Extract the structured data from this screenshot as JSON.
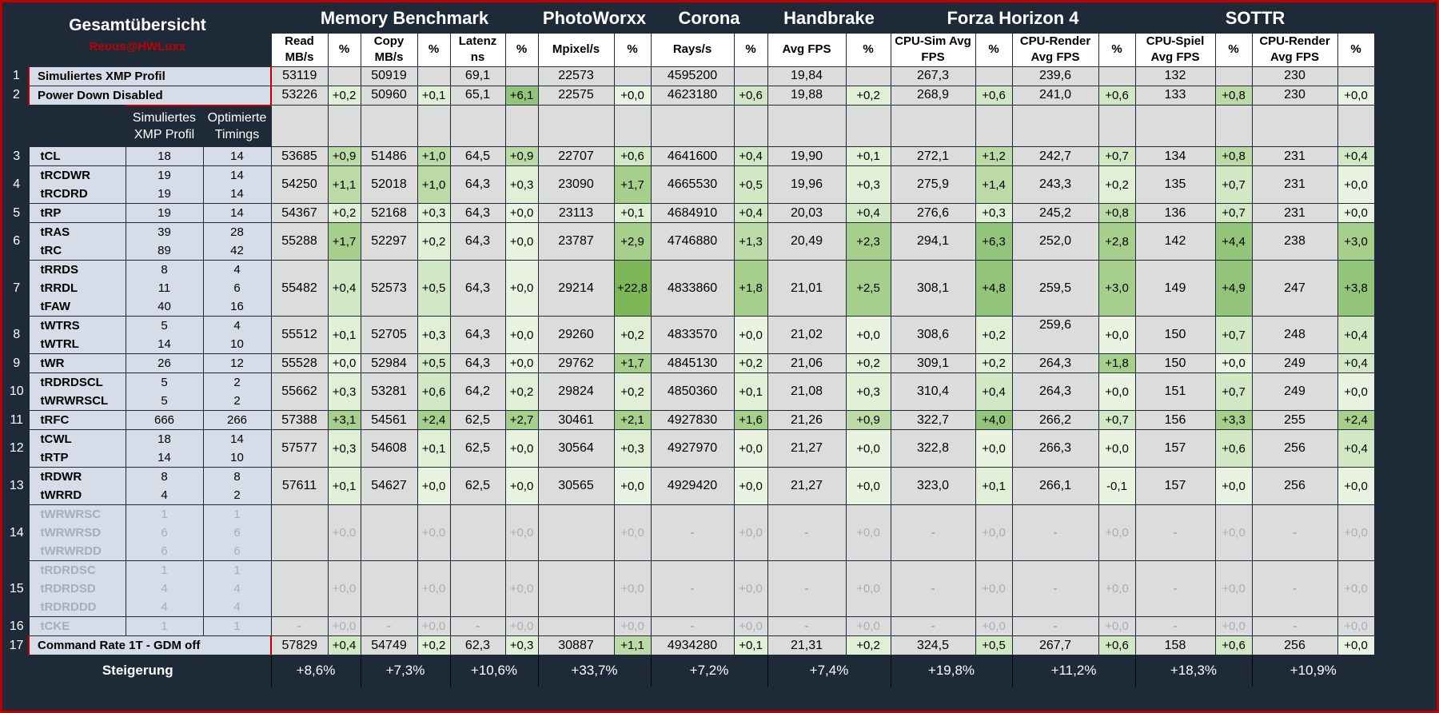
{
  "title": "Gesamtübersicht",
  "author": "Reous@HWLuxx",
  "groups": [
    "Memory Benchmark",
    "PhotoWorxx",
    "Corona",
    "Handbrake",
    "Forza Horizon 4",
    "SOTTR"
  ],
  "col_headers": [
    "Read MB/s",
    "%",
    "Copy MB/s",
    "%",
    "Latenz ns",
    "%",
    "Mpixel/s",
    "%",
    "Rays/s",
    "%",
    "Avg FPS",
    "%",
    "CPU-Sim Avg FPS",
    "%",
    "CPU-Render Avg FPS",
    "%",
    "CPU-Spiel Avg FPS",
    "%",
    "CPU-Render Avg FPS",
    "%"
  ],
  "timing_headers": [
    "Simuliertes XMP Profil",
    "Optimierte Timings"
  ],
  "footer_label": "Steigerung",
  "footer": [
    "+8,6%",
    "+7,3%",
    "+10,6%",
    "+33,7%",
    "+7,2%",
    "+7,4%",
    "+19,8%",
    "+11,2%",
    "+18,3%",
    "+10,9%"
  ],
  "colors": {
    "background": "#1f2a38",
    "accent": "#c00000",
    "label_bg": "#d6dde8",
    "data_bg": "#dcdcdc",
    "header_bg": "#ffffff"
  },
  "rows": [
    {
      "n": "1",
      "labels": [
        "Simuliertes XMP Profil"
      ],
      "values": [
        "53119",
        "",
        "50919",
        "",
        "69,1",
        "",
        "22573",
        "",
        "4595200",
        "",
        "19,84",
        "",
        "267,3",
        "",
        "239,6",
        "",
        "132",
        "",
        "230",
        ""
      ]
    },
    {
      "n": "2",
      "labels": [
        "Power Down Disabled"
      ],
      "values": [
        "53226",
        "+0,2",
        "50960",
        "+0,1",
        "65,1",
        "+6,1",
        "22575",
        "+0,0",
        "4623180",
        "+0,6",
        "19,88",
        "+0,2",
        "268,9",
        "+0,6",
        "241,0",
        "+0,6",
        "133",
        "+0,8",
        "230",
        "+0,0"
      ]
    },
    {
      "n": "3",
      "labels": [
        "tCL"
      ],
      "xmp": [
        "18"
      ],
      "opt": [
        "14"
      ],
      "values": [
        "53685",
        "+0,9",
        "51486",
        "+1,0",
        "64,5",
        "+0,9",
        "22707",
        "+0,6",
        "4641600",
        "+0,4",
        "19,90",
        "+0,1",
        "272,1",
        "+1,2",
        "242,7",
        "+0,7",
        "134",
        "+0,8",
        "231",
        "+0,4"
      ]
    },
    {
      "n": "4",
      "labels": [
        "tRCDWR",
        "tRCDRD"
      ],
      "xmp": [
        "19",
        "19"
      ],
      "opt": [
        "14",
        "14"
      ],
      "values": [
        "54250",
        "+1,1",
        "52018",
        "+1,0",
        "64,3",
        "+0,3",
        "23090",
        "+1,7",
        "4665530",
        "+0,5",
        "19,96",
        "+0,3",
        "275,9",
        "+1,4",
        "243,3",
        "+0,2",
        "135",
        "+0,7",
        "231",
        "+0,0"
      ]
    },
    {
      "n": "5",
      "labels": [
        "tRP"
      ],
      "xmp": [
        "19"
      ],
      "opt": [
        "14"
      ],
      "values": [
        "54367",
        "+0,2",
        "52168",
        "+0,3",
        "64,3",
        "+0,0",
        "23113",
        "+0,1",
        "4684910",
        "+0,4",
        "20,03",
        "+0,4",
        "276,6",
        "+0,3",
        "245,2",
        "+0,8",
        "136",
        "+0,7",
        "231",
        "+0,0"
      ]
    },
    {
      "n": "6",
      "labels": [
        "tRAS",
        "tRC"
      ],
      "xmp": [
        "39",
        "89"
      ],
      "opt": [
        "28",
        "42"
      ],
      "values": [
        "55288",
        "+1,7",
        "52297",
        "+0,2",
        "64,3",
        "+0,0",
        "23787",
        "+2,9",
        "4746880",
        "+1,3",
        "20,49",
        "+2,3",
        "294,1",
        "+6,3",
        "252,0",
        "+2,8",
        "142",
        "+4,4",
        "238",
        "+3,0"
      ]
    },
    {
      "n": "7",
      "labels": [
        "tRRDS",
        "tRRDL",
        "tFAW"
      ],
      "xmp": [
        "8",
        "11",
        "40"
      ],
      "opt": [
        "4",
        "6",
        "16"
      ],
      "values": [
        "55482",
        "+0,4",
        "52573",
        "+0,5",
        "64,3",
        "+0,0",
        "29214",
        "+22,8",
        "4833860",
        "+1,8",
        "21,01",
        "+2,5",
        "308,1",
        "+4,8",
        "259,5",
        "+3,0",
        "149",
        "+4,9",
        "247",
        "+3,8"
      ]
    },
    {
      "n": "8",
      "labels": [
        "tWTRS",
        "tWTRL"
      ],
      "xmp": [
        "5",
        "14"
      ],
      "opt": [
        "4",
        "10"
      ],
      "values": [
        "55512",
        "+0,1",
        "52705",
        "+0,3",
        "64,3",
        "+0,0",
        "29260",
        "+0,2",
        "4833570",
        "+0,0",
        "21,02",
        "+0,0",
        "308,6",
        "+0,2",
        "259,6",
        "+0,0",
        "150",
        "+0,7",
        "248",
        "+0,4"
      ]
    },
    {
      "n": "9",
      "labels": [
        "tWR"
      ],
      "xmp": [
        "26"
      ],
      "opt": [
        "12"
      ],
      "values": [
        "55528",
        "+0,0",
        "52984",
        "+0,5",
        "64,3",
        "+0,0",
        "29762",
        "+1,7",
        "4845130",
        "+0,2",
        "21,06",
        "+0,2",
        "309,1",
        "+0,2",
        "264,3",
        "+1,8",
        "150",
        "+0,0",
        "249",
        "+0,4"
      ]
    },
    {
      "n": "10",
      "labels": [
        "tRDRDSCL",
        "tWRWRSCL"
      ],
      "xmp": [
        "5",
        "5"
      ],
      "opt": [
        "2",
        "2"
      ],
      "values": [
        "55662",
        "+0,3",
        "53281",
        "+0,6",
        "64,2",
        "+0,2",
        "29824",
        "+0,2",
        "4850360",
        "+0,1",
        "21,08",
        "+0,3",
        "310,4",
        "+0,4",
        "264,3",
        "+0,0",
        "151",
        "+0,7",
        "249",
        "+0,0"
      ]
    },
    {
      "n": "11",
      "labels": [
        "tRFC"
      ],
      "xmp": [
        "666"
      ],
      "opt": [
        "266"
      ],
      "values": [
        "57388",
        "+3,1",
        "54561",
        "+2,4",
        "62,5",
        "+2,7",
        "30461",
        "+2,1",
        "4927830",
        "+1,6",
        "21,26",
        "+0,9",
        "322,7",
        "+4,0",
        "266,2",
        "+0,7",
        "156",
        "+3,3",
        "255",
        "+2,4"
      ]
    },
    {
      "n": "12",
      "labels": [
        "tCWL",
        "tRTP"
      ],
      "xmp": [
        "18",
        "14"
      ],
      "opt": [
        "14",
        "10"
      ],
      "values": [
        "57577",
        "+0,3",
        "54608",
        "+0,1",
        "62,5",
        "+0,0",
        "30564",
        "+0,3",
        "4927970",
        "+0,0",
        "21,27",
        "+0,0",
        "322,8",
        "+0,0",
        "266,3",
        "+0,0",
        "157",
        "+0,6",
        "256",
        "+0,4"
      ]
    },
    {
      "n": "13",
      "labels": [
        "tRDWR",
        "tWRRD"
      ],
      "xmp": [
        "8",
        "4"
      ],
      "opt": [
        "8",
        "2"
      ],
      "values": [
        "57611",
        "+0,1",
        "54627",
        "+0,0",
        "62,5",
        "+0,0",
        "30565",
        "+0,0",
        "4929420",
        "+0,0",
        "21,27",
        "+0,0",
        "323,0",
        "+0,1",
        "266,1",
        "-0,1",
        "157",
        "+0,0",
        "256",
        "+0,0"
      ]
    },
    {
      "n": "14",
      "faded": true,
      "labels": [
        "tWRWRSC",
        "tWRWRSD",
        "tWRWRDD"
      ],
      "xmp": [
        "1",
        "6",
        "6"
      ],
      "opt": [
        "1",
        "6",
        "6"
      ],
      "values": [
        "",
        "+0,0",
        "",
        "+0,0",
        "",
        "+0,0",
        "",
        "+0,0",
        "-",
        "+0,0",
        "-",
        "+0,0",
        "-",
        "+0,0",
        "-",
        "+0,0",
        "-",
        "+0,0",
        "-",
        "+0,0"
      ]
    },
    {
      "n": "15",
      "faded": true,
      "labels": [
        "tRDRDSC",
        "tRDRDSD",
        "tRDRDDD"
      ],
      "xmp": [
        "1",
        "4",
        "4"
      ],
      "opt": [
        "1",
        "4",
        "4"
      ],
      "values": [
        "",
        "+0,0",
        "",
        "+0,0",
        "",
        "+0,0",
        "",
        "+0,0",
        "-",
        "+0,0",
        "-",
        "+0,0",
        "-",
        "+0,0",
        "-",
        "+0,0",
        "-",
        "+0,0",
        "-",
        "+0,0"
      ]
    },
    {
      "n": "16",
      "faded": true,
      "labels": [
        "tCKE"
      ],
      "xmp": [
        "1"
      ],
      "opt": [
        "1"
      ],
      "values": [
        "-",
        "+0,0",
        "-",
        "+0,0",
        "-",
        "+0,0",
        "",
        "+0,0",
        "-",
        "+0,0",
        "-",
        "+0,0",
        "-",
        "+0,0",
        "-",
        "+0,0",
        "-",
        "+0,0",
        "-",
        "+0,0"
      ]
    },
    {
      "n": "17",
      "labels": [
        "Command Rate 1T - GDM off"
      ],
      "values": [
        "57829",
        "+0,4",
        "54749",
        "+0,2",
        "62,3",
        "+0,3",
        "30887",
        "+1,1",
        "4934280",
        "+0,1",
        "21,31",
        "+0,2",
        "324,5",
        "+0,5",
        "267,7",
        "+0,6",
        "158",
        "+0,6",
        "256",
        "+0,0"
      ]
    }
  ]
}
